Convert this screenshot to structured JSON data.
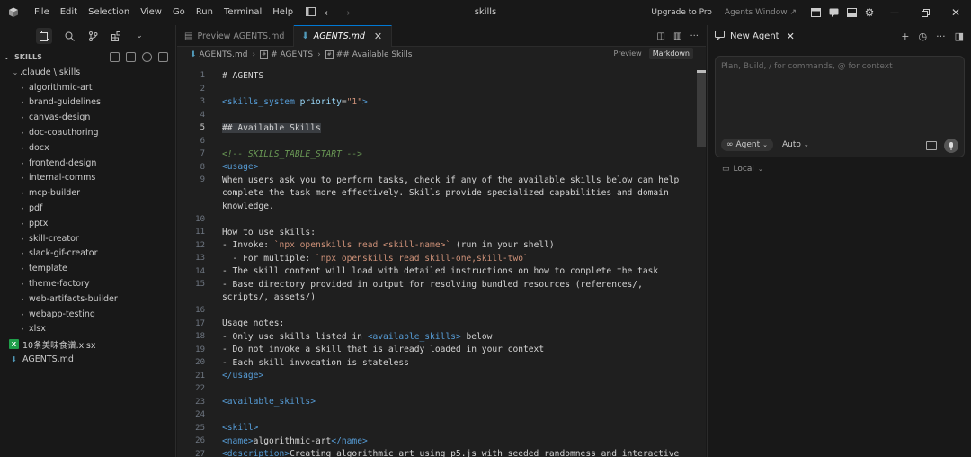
{
  "menu": [
    "File",
    "Edit",
    "Selection",
    "View",
    "Go",
    "Run",
    "Terminal",
    "Help"
  ],
  "window": {
    "title": "skills",
    "upgrade": "Upgrade to Pro",
    "agents_window": "Agents Window"
  },
  "sidebar": {
    "header": "SKILLS",
    "root": ".claude \\ skills",
    "folders": [
      "algorithmic-art",
      "brand-guidelines",
      "canvas-design",
      "doc-coauthoring",
      "docx",
      "frontend-design",
      "internal-comms",
      "mcp-builder",
      "pdf",
      "pptx",
      "skill-creator",
      "slack-gif-creator",
      "template",
      "theme-factory",
      "web-artifacts-builder",
      "webapp-testing",
      "xlsx"
    ],
    "files": [
      {
        "name": "10条美味食谱.xlsx",
        "icon": "xlsx-icon"
      },
      {
        "name": "AGENTS.md",
        "icon": "markdown-icon"
      }
    ]
  },
  "editor": {
    "tabs": [
      {
        "label": "Preview AGENTS.md",
        "active": false
      },
      {
        "label": "AGENTS.md",
        "active": true
      }
    ],
    "breadcrumbs": [
      "AGENTS.md",
      "# AGENTS",
      "## Available Skills"
    ],
    "view_preview": "Preview",
    "view_markdown": "Markdown",
    "current_line": "5",
    "lines": [
      {
        "n": "1",
        "t": "# AGENTS"
      },
      {
        "n": "2",
        "t": ""
      },
      {
        "n": "3",
        "t": "<skills_system priority=\"1\">"
      },
      {
        "n": "4",
        "t": ""
      },
      {
        "n": "5",
        "t": "## Available Skills"
      },
      {
        "n": "6",
        "t": ""
      },
      {
        "n": "7",
        "t": "<!-- SKILLS_TABLE_START -->"
      },
      {
        "n": "8",
        "t": "<usage>"
      },
      {
        "n": "9",
        "t": "When users ask you to perform tasks, check if any of the available skills below can help"
      },
      {
        "n": "",
        "t": "complete the task more effectively. Skills provide specialized capabilities and domain"
      },
      {
        "n": "",
        "t": "knowledge."
      },
      {
        "n": "10",
        "t": ""
      },
      {
        "n": "11",
        "t": "How to use skills:"
      },
      {
        "n": "12",
        "t": "- Invoke: `npx openskills read <skill-name>` (run in your shell)"
      },
      {
        "n": "13",
        "t": "  - For multiple: `npx openskills read skill-one,skill-two`"
      },
      {
        "n": "14",
        "t": "- The skill content will load with detailed instructions on how to complete the task"
      },
      {
        "n": "15",
        "t": "- Base directory provided in output for resolving bundled resources (references/,"
      },
      {
        "n": "",
        "t": "scripts/, assets/)"
      },
      {
        "n": "16",
        "t": ""
      },
      {
        "n": "17",
        "t": "Usage notes:"
      },
      {
        "n": "18",
        "t": "- Only use skills listed in <available_skills> below"
      },
      {
        "n": "19",
        "t": "- Do not invoke a skill that is already loaded in your context"
      },
      {
        "n": "20",
        "t": "- Each skill invocation is stateless"
      },
      {
        "n": "21",
        "t": "</usage>"
      },
      {
        "n": "22",
        "t": ""
      },
      {
        "n": "23",
        "t": "<available_skills>"
      },
      {
        "n": "24",
        "t": ""
      },
      {
        "n": "25",
        "t": "<skill>"
      },
      {
        "n": "26",
        "t": "<name>algorithmic-art</name>"
      },
      {
        "n": "27",
        "t": "<description>Creating algorithmic art using p5.js with seeded randomness and interactive"
      }
    ]
  },
  "agent": {
    "tab_label": "New Agent",
    "placeholder": "Plan, Build, / for commands, @ for context",
    "mode": "Agent",
    "model": "Auto",
    "env": "Local"
  }
}
